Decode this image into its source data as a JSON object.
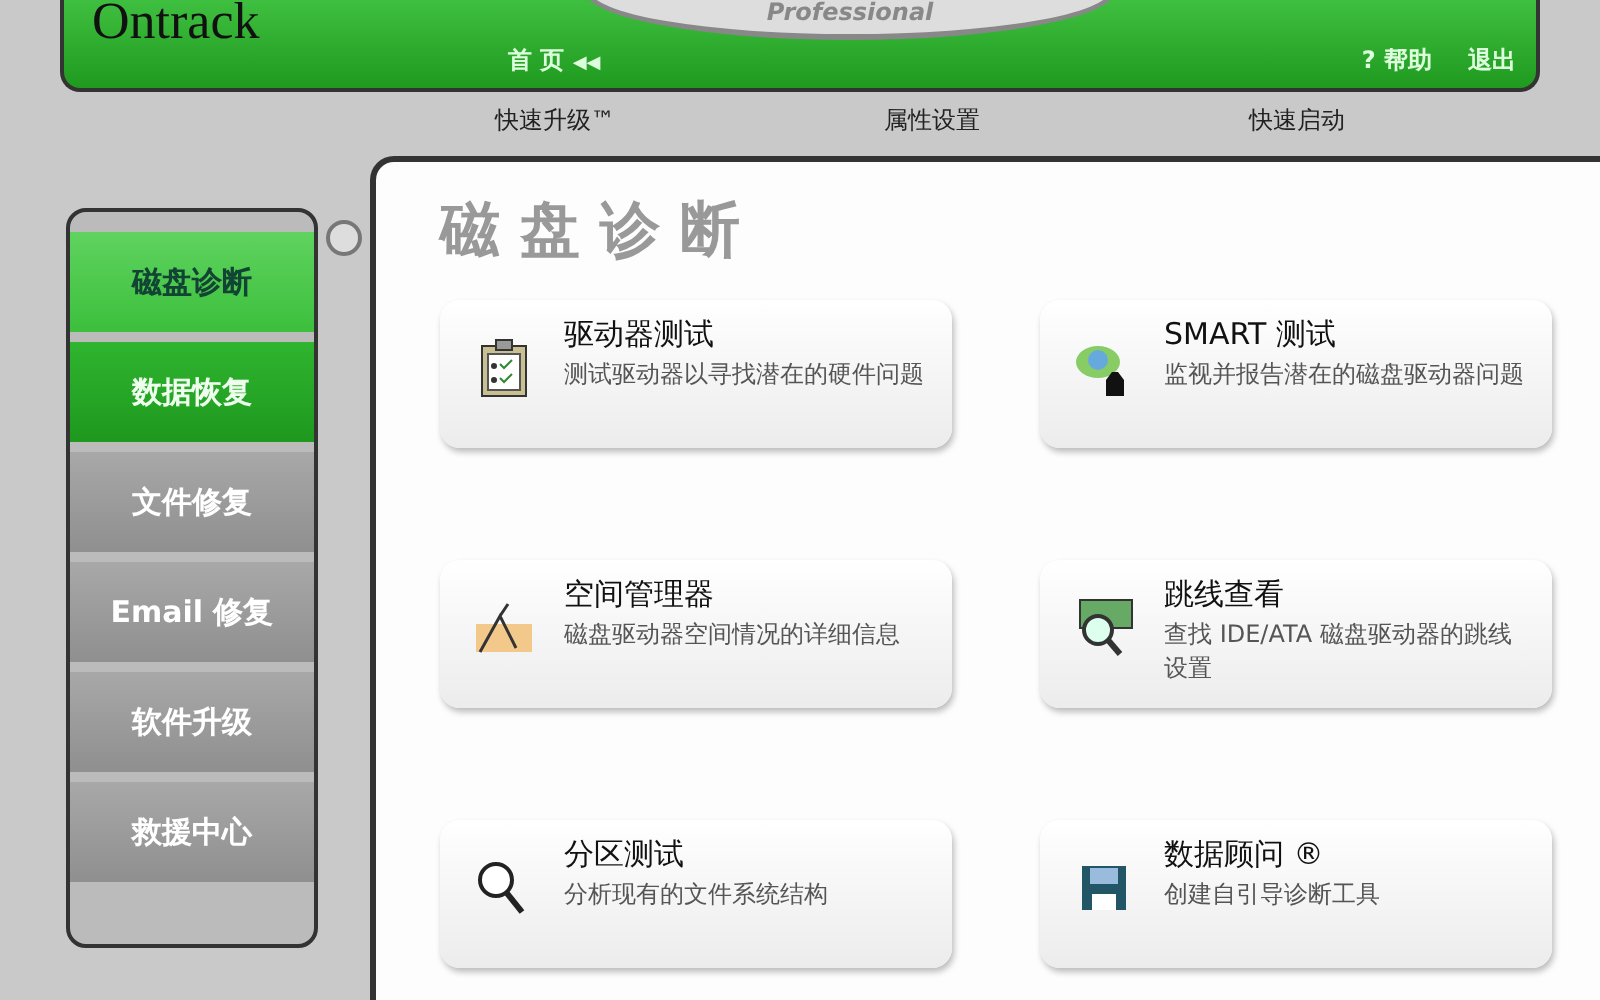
{
  "header": {
    "logo": "Ontrack",
    "edition": "Professional",
    "home": "首 页",
    "home_icon": "◀◀",
    "help_icon": "?",
    "help": "帮助",
    "exit": "退出"
  },
  "toolbar": [
    "快速升级™",
    "属性设置",
    "快速启动"
  ],
  "sidebar": {
    "items": [
      {
        "label": "磁盘诊断",
        "selected": true,
        "highlighted": false
      },
      {
        "label": "数据恢复",
        "selected": false,
        "highlighted": true
      },
      {
        "label": "文件修复",
        "selected": false,
        "highlighted": false
      },
      {
        "label": "Email 修复",
        "selected": false,
        "highlighted": false
      },
      {
        "label": "软件升级",
        "selected": false,
        "highlighted": false
      },
      {
        "label": "救援中心",
        "selected": false,
        "highlighted": false
      }
    ]
  },
  "main": {
    "title": "磁盘诊断",
    "tools": [
      {
        "title": "驱动器测试",
        "description": "测试驱动器以寻找潜在的硬件问题"
      },
      {
        "title": "SMART 测试",
        "description": "监视并报告潜在的磁盘驱动器问题"
      },
      {
        "title": "空间管理器",
        "description": "磁盘驱动器空间情况的详细信息"
      },
      {
        "title": "跳线查看",
        "description": "查找 IDE/ATA 磁盘驱动器的跳线设置"
      },
      {
        "title": "分区测试",
        "description": "分析现有的文件系统结构"
      },
      {
        "title": "数据顾问 ®",
        "description": "创建自引导诊断工具"
      }
    ]
  }
}
